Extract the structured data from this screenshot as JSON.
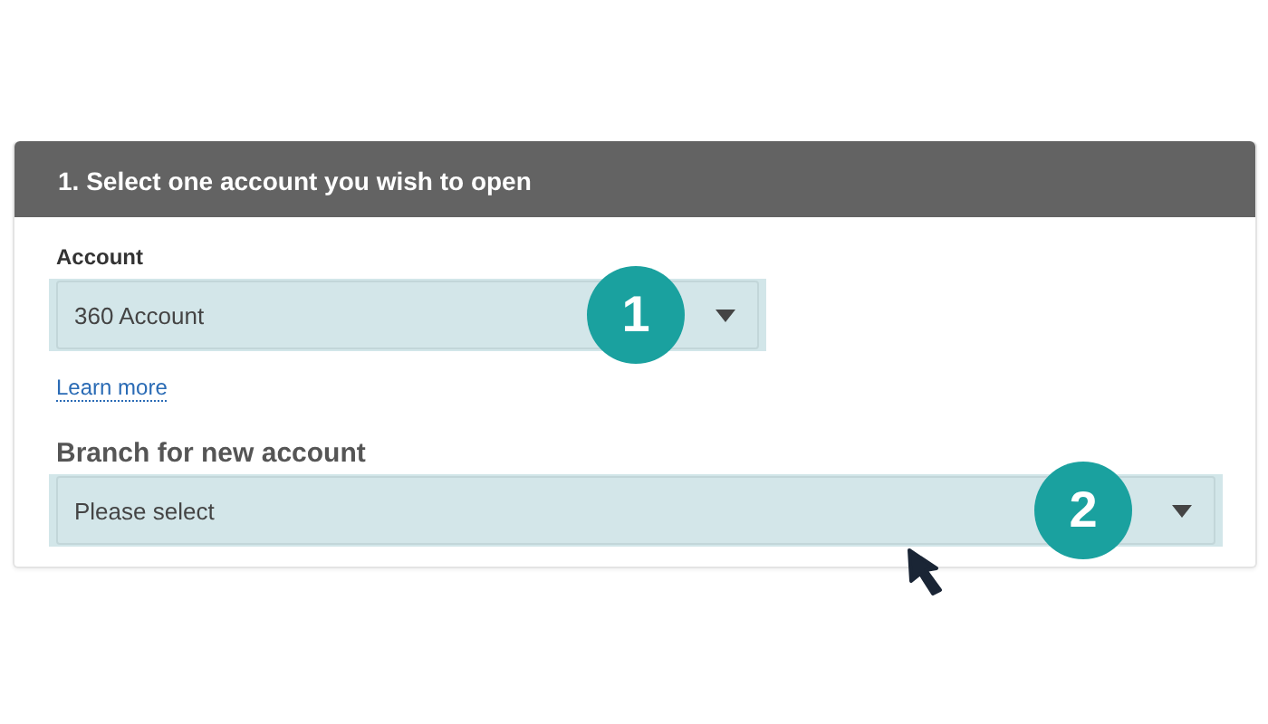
{
  "section": {
    "title": "1. Select one account you wish to open"
  },
  "fields": [
    {
      "kind": "compact",
      "label": "Account",
      "value": "360 Account",
      "marker": "1",
      "link": "Learn more"
    },
    {
      "kind": "large",
      "label": "Branch for new account",
      "value": "Please select",
      "marker": "2"
    }
  ]
}
